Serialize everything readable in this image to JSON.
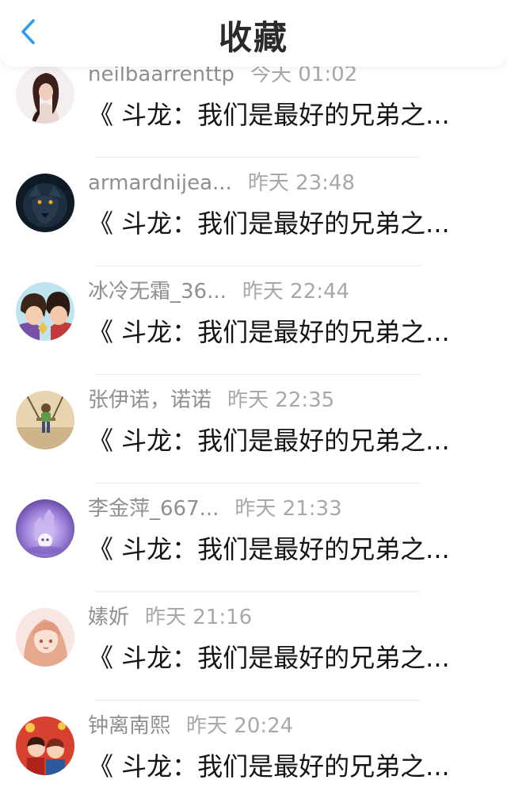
{
  "header": {
    "title": "收藏",
    "back_icon": "chevron-left-icon",
    "accent_color": "#2d9cf0"
  },
  "favorites": [
    {
      "username": "neilbaarrenttp",
      "time": "今天 01:02",
      "title": "《 斗龙：我们是最好的兄弟之...",
      "avatar": "avatar-woman-icon"
    },
    {
      "username": "armardnijea...",
      "time": "昨天 23:48",
      "title": "《 斗龙：我们是最好的兄弟之...",
      "avatar": "avatar-wolf-icon"
    },
    {
      "username": "冰冷无霜_36...",
      "time": "昨天 22:44",
      "title": "《 斗龙：我们是最好的兄弟之...",
      "avatar": "avatar-anime-boys-icon"
    },
    {
      "username": "张伊诺，诺诺",
      "time": "昨天 22:35",
      "title": "《 斗龙：我们是最好的兄弟之...",
      "avatar": "avatar-child-swing-icon"
    },
    {
      "username": "李金萍_667...",
      "time": "昨天 21:33",
      "title": "《 斗龙：我们是最好的兄弟之...",
      "avatar": "avatar-purple-castle-icon"
    },
    {
      "username": "嫊妡",
      "time": "昨天 21:16",
      "title": "《 斗龙：我们是最好的兄弟之...",
      "avatar": "avatar-anime-girl-icon"
    },
    {
      "username": "钟离南熙",
      "time": "昨天 20:24",
      "title": "《 斗龙：我们是最好的兄弟之...",
      "avatar": "avatar-red-cartoon-icon"
    }
  ]
}
